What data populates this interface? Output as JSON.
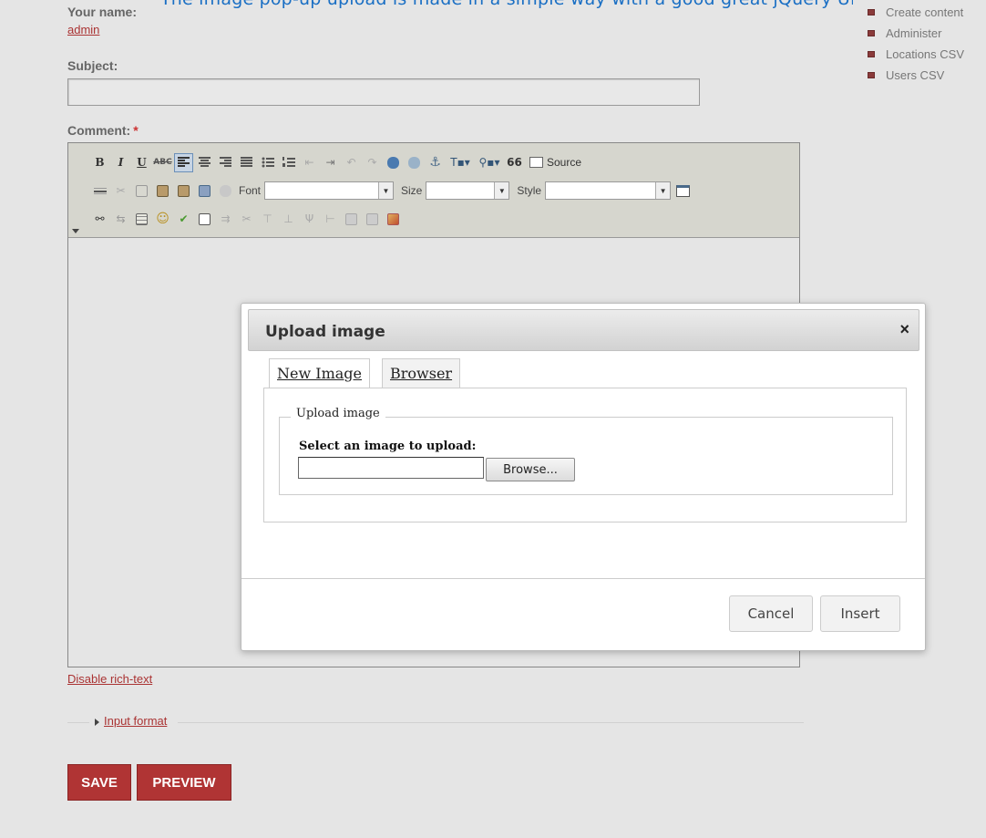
{
  "top_cutoff_text": "The image pop-up upload is made in a simple way with a good great jQuery UI theme popup",
  "form": {
    "your_name_label": "Your name:",
    "your_name_value": "admin",
    "subject_label": "Subject:",
    "subject_value": "",
    "comment_label": "Comment:",
    "required_mark": "*",
    "disable_richtext": "Disable rich-text",
    "input_format": "Input format",
    "save_label": "SAVE",
    "preview_label": "PREVIEW"
  },
  "menu": {
    "items": [
      {
        "label": "Create content"
      },
      {
        "label": "Administer"
      },
      {
        "label": "Locations CSV"
      },
      {
        "label": "Users CSV"
      }
    ]
  },
  "toolbar": {
    "source_label": "Source",
    "font_label": "Font",
    "size_label": "Size",
    "style_label": "Style",
    "font_value": "",
    "size_value": "",
    "style_value": "",
    "quote_glyph": "66"
  },
  "dialog": {
    "title": "Upload image",
    "close_glyph": "×",
    "tabs": [
      {
        "label": "New Image",
        "active": true
      },
      {
        "label": "Browser",
        "active": false
      }
    ],
    "legend": "Upload image",
    "select_label": "Select an image to upload:",
    "file_value": "",
    "browse_label": "Browse...",
    "cancel_label": "Cancel",
    "insert_label": "Insert"
  }
}
